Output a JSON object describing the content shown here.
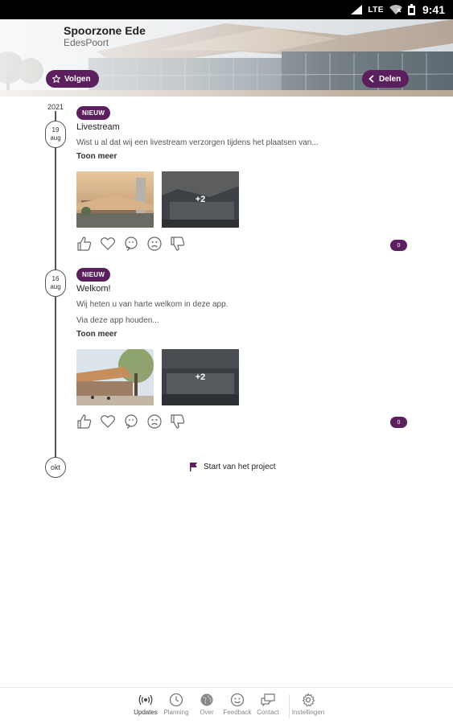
{
  "status_bar": {
    "network": "LTE",
    "time": "9:41"
  },
  "header": {
    "title": "Spoorzone Ede",
    "subtitle": "EdesPoort",
    "follow_label": "Volgen",
    "share_label": "Delen"
  },
  "timeline": {
    "year": "2021",
    "posts": [
      {
        "day": "19",
        "month": "aug",
        "badge": "NIEUW",
        "title": "Livestream",
        "body": "Wist u al dat wij een livestream verzorgen tijdens het plaatsen van...",
        "body2": "",
        "show_more": "Toon meer",
        "more_images": "+2",
        "reaction_count": "0"
      },
      {
        "day": "16",
        "month": "aug",
        "badge": "NIEUW",
        "title": "Welkom!",
        "body": "Wij heten u van harte welkom in deze app.",
        "body2": "Via deze app houden...",
        "show_more": "Toon meer",
        "more_images": "+2",
        "reaction_count": "0"
      }
    ],
    "end_month": "okt",
    "project_start": "Start van het project"
  },
  "bottom_nav": {
    "items": [
      {
        "label": "Updates",
        "icon": "broadcast-icon",
        "active": true
      },
      {
        "label": "Planning",
        "icon": "clock-icon",
        "active": false
      },
      {
        "label": "Over",
        "icon": "globe-icon",
        "active": false
      },
      {
        "label": "Feedback",
        "icon": "smiley-icon",
        "active": false
      },
      {
        "label": "Contact",
        "icon": "chat-icon",
        "active": false
      },
      {
        "label": "Instellingen",
        "icon": "gear-icon",
        "active": false
      }
    ]
  },
  "colors": {
    "accent": "#5b1f5e",
    "timeline": "#555555"
  }
}
